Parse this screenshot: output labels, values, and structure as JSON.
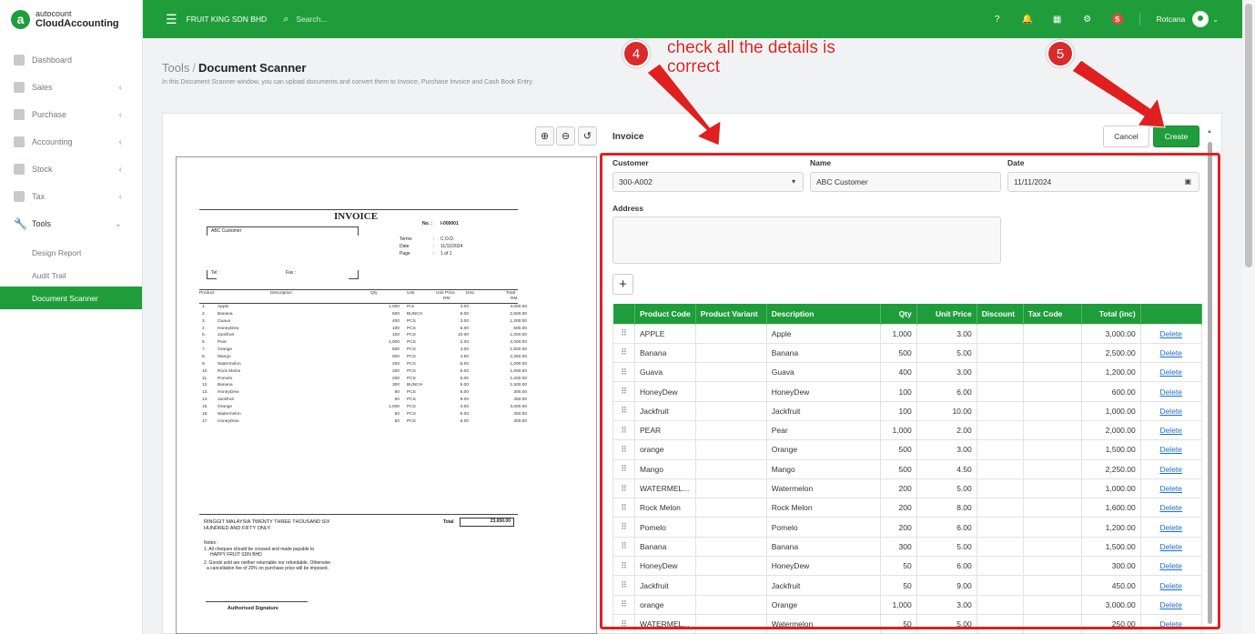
{
  "app": {
    "logo_small": "autocount",
    "logo_big": "CloudAccounting",
    "logo_mark": "a"
  },
  "topbar": {
    "company": "FRUIT KING SDN BHD",
    "search_placeholder": "Search...",
    "badge": "S",
    "username": "Rotcana"
  },
  "sidebar": {
    "items": [
      {
        "label": "Dashboard"
      },
      {
        "label": "Sales"
      },
      {
        "label": "Purchase"
      },
      {
        "label": "Accounting"
      },
      {
        "label": "Stock"
      },
      {
        "label": "Tax"
      },
      {
        "label": "Tools"
      }
    ],
    "sub": [
      {
        "label": "Design Report"
      },
      {
        "label": "Audit Trail"
      },
      {
        "label": "Document Scanner"
      }
    ]
  },
  "header": {
    "crumb_parent": "Tools",
    "crumb_sep": "/",
    "title": "Document Scanner",
    "description": "In this Document Scanner window, you can upload documents and convert them to Invoice, Purchase Invoice and Cash Book Entry."
  },
  "document": {
    "heading": "INVOICE",
    "no_label": "No. :",
    "no_value": "I-000001",
    "customer": "ABC Customer",
    "terms_label": "Terms",
    "terms_value": "C.O.D.",
    "date_label": "Date",
    "date_value": "11/11/2024",
    "page_label": "Page",
    "page_value": "1 of 1",
    "colon": ":",
    "tel_label": "Tel :",
    "fax_label": "Fax :",
    "columns": [
      "Product",
      "Description",
      "Qty",
      "Unit",
      "Unit Price",
      "Disc.",
      "Total"
    ],
    "currency": "RM",
    "rows": [
      [
        "1.",
        "Apple",
        "1,000",
        "Pcs",
        "3.00",
        "3,000.00"
      ],
      [
        "2.",
        "Banana",
        "500",
        "BUNCH",
        "5.00",
        "2,500.00"
      ],
      [
        "3.",
        "Guava",
        "400",
        "PCS",
        "3.00",
        "1,200.00"
      ],
      [
        "4.",
        "HoneyDew",
        "100",
        "PCS",
        "6.00",
        "600.00"
      ],
      [
        "5.",
        "Jackfruit",
        "100",
        "PCS",
        "10.00",
        "1,000.00"
      ],
      [
        "6.",
        "Pear",
        "1,000",
        "PCS",
        "2.00",
        "2,000.00"
      ],
      [
        "7.",
        "Orange",
        "500",
        "PCS",
        "3.00",
        "1,500.00"
      ],
      [
        "8.",
        "Mango",
        "500",
        "PCS",
        "4.50",
        "2,250.00"
      ],
      [
        "9.",
        "Watermelon",
        "200",
        "PCS",
        "5.00",
        "1,000.00"
      ],
      [
        "10.",
        "Rock Melon",
        "200",
        "PCS",
        "8.00",
        "1,600.00"
      ],
      [
        "11.",
        "Pomelo",
        "200",
        "PCS",
        "6.00",
        "1,200.00"
      ],
      [
        "12.",
        "Banana",
        "300",
        "BUNCH",
        "5.00",
        "1,500.00"
      ],
      [
        "13.",
        "HoneyDew",
        "50",
        "PCS",
        "6.00",
        "300.00"
      ],
      [
        "14.",
        "Jackfruit",
        "50",
        "PCS",
        "9.00",
        "450.00"
      ],
      [
        "15.",
        "Orange",
        "1,000",
        "PCS",
        "3.00",
        "3,000.00"
      ],
      [
        "16.",
        "Watermelon",
        "50",
        "PCS",
        "5.00",
        "250.00"
      ],
      [
        "17.",
        "HoneyDew",
        "50",
        "PCS",
        "6.00",
        "300.00"
      ]
    ],
    "amount_words_1": "RINGGIT MALAYSIA TWENTY THREE THOUSAND SIX",
    "amount_words_2": "HUNDRED AND FIFTY ONLY.",
    "total_label": "Total",
    "total_value": "23,650.00",
    "notes_label": "Notes :",
    "note1a": "1. All cheques should be crossed and made payable to",
    "note1b": "HAPPY FRUIT SDN BHD",
    "note2a": "2. Goods sold are neither returnable nor refundable. Otherwise",
    "note2b": "a cancellation fee of 20% on purchase price will be imposed.",
    "signature": "Authorised Signature"
  },
  "form": {
    "title": "Invoice",
    "cancel": "Cancel",
    "create": "Create",
    "customer_label": "Customer",
    "customer_value": "300-A002",
    "name_label": "Name",
    "name_value": "ABC Customer",
    "date_label": "Date",
    "date_value": "11/11/2024",
    "address_label": "Address",
    "add_symbol": "+",
    "columns": [
      "",
      "Product Code",
      "Product Variant",
      "Description",
      "Qty",
      "Unit Price",
      "Discount",
      "Tax Code",
      "Total (inc)",
      ""
    ],
    "delete_label": "Delete",
    "rows": [
      [
        "APPLE",
        "",
        "Apple",
        "1,000",
        "3.00",
        "",
        "",
        "3,000.00"
      ],
      [
        "Banana",
        "",
        "Banana",
        "500",
        "5.00",
        "",
        "",
        "2,500.00"
      ],
      [
        "Guava",
        "",
        "Guava",
        "400",
        "3.00",
        "",
        "",
        "1,200.00"
      ],
      [
        "HoneyDew",
        "",
        "HoneyDew",
        "100",
        "6.00",
        "",
        "",
        "600.00"
      ],
      [
        "Jackfruit",
        "",
        "Jackfruit",
        "100",
        "10.00",
        "",
        "",
        "1,000.00"
      ],
      [
        "PEAR",
        "",
        "Pear",
        "1,000",
        "2.00",
        "",
        "",
        "2,000.00"
      ],
      [
        "orange",
        "",
        "Orange",
        "500",
        "3.00",
        "",
        "",
        "1,500.00"
      ],
      [
        "Mango",
        "",
        "Mango",
        "500",
        "4.50",
        "",
        "",
        "2,250.00"
      ],
      [
        "WATERMEL...",
        "",
        "Watermelon",
        "200",
        "5.00",
        "",
        "",
        "1,000.00"
      ],
      [
        "Rock Melon",
        "",
        "Rock Melon",
        "200",
        "8.00",
        "",
        "",
        "1,600.00"
      ],
      [
        "Pomelo",
        "",
        "Pomelo",
        "200",
        "6.00",
        "",
        "",
        "1,200.00"
      ],
      [
        "Banana",
        "",
        "Banana",
        "300",
        "5.00",
        "",
        "",
        "1,500.00"
      ],
      [
        "HoneyDew",
        "",
        "HoneyDew",
        "50",
        "6.00",
        "",
        "",
        "300.00"
      ],
      [
        "Jackfruit",
        "",
        "Jackfruit",
        "50",
        "9.00",
        "",
        "",
        "450.00"
      ],
      [
        "orange",
        "",
        "Orange",
        "1,000",
        "3.00",
        "",
        "",
        "3,000.00"
      ],
      [
        "WATERMEL...",
        "",
        "Watermelon",
        "50",
        "5.00",
        "",
        "",
        "250.00"
      ]
    ]
  },
  "annotations": {
    "step4": "4",
    "step5": "5",
    "note": "check all the details is correct"
  },
  "colors": {
    "brand": "#1f9d3a",
    "annotation": "#e02020",
    "link": "#1e6fd0"
  },
  "icons": [
    "menu-icon",
    "search-icon",
    "help-icon",
    "bell-icon",
    "apps-grid-icon",
    "gear-icon",
    "zoom-in-icon",
    "zoom-out-icon",
    "rotate-icon",
    "calendar-icon",
    "drag-handle-icon"
  ]
}
